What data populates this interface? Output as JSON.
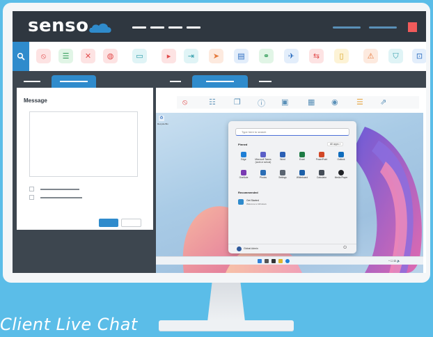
{
  "brand": {
    "logo_text": "senso.",
    "accent": "#2f8bcc",
    "dark": "#2f3740",
    "close_color": "#f15b5b"
  },
  "toolbar": {
    "icons": [
      "block-icon",
      "checklist-icon",
      "mute-icon",
      "web-icon",
      "remote-desktop-icon",
      "play-video-icon",
      "login-icon",
      "send-icon",
      "document-icon",
      "share-icon",
      "launch-icon",
      "usb-icon",
      "power-icon",
      "alert-icon",
      "shield-icon",
      "screenshot-icon"
    ]
  },
  "message_panel": {
    "title": "Message"
  },
  "remote_tools": {
    "icons": [
      "block-icon",
      "list-icon",
      "clipboard-icon",
      "info-icon",
      "monitor-icon",
      "qr-icon",
      "camera-icon",
      "settings-icon",
      "export-icon"
    ]
  },
  "remote_desktop": {
    "recycle_bin": "Recycle Bin",
    "search_placeholder": "Type here to search",
    "pinned_label": "Pinned",
    "all_apps": "All apps >",
    "apps": [
      {
        "name": "Edge",
        "color": "#1f7fd6"
      },
      {
        "name": "Microsoft Teams (work or school)",
        "color": "#5b5fc7"
      },
      {
        "name": "Word",
        "color": "#2b5fb4"
      },
      {
        "name": "Excel",
        "color": "#1d7a43"
      },
      {
        "name": "PowerPoint",
        "color": "#d24726"
      },
      {
        "name": "Outlook",
        "color": "#0f6cbd"
      },
      {
        "name": "OneNote",
        "color": "#7a3ab2"
      },
      {
        "name": "Photos",
        "color": "#2a6db5"
      },
      {
        "name": "Settings",
        "color": "#5a6470"
      },
      {
        "name": "Whiteboard",
        "color": "#1b5fa8"
      },
      {
        "name": "Calculator",
        "color": "#444c56"
      },
      {
        "name": "Media Player",
        "color": "#202226"
      }
    ],
    "recommended_label": "Recommended",
    "recommended_item": {
      "title": "Get Started",
      "subtitle": "Welcome to Windows"
    },
    "user_name": "Global Admin",
    "tray_text": "^ ☐ ☊ 🔈"
  },
  "caption": "Client Live Chat"
}
